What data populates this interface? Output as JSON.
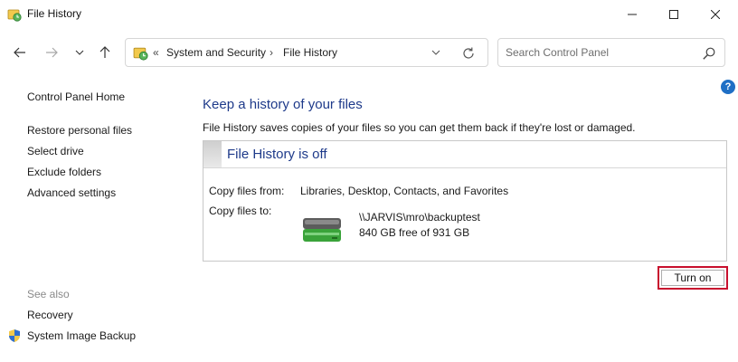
{
  "window": {
    "title": "File History",
    "icon": "file-history-icon"
  },
  "nav": {
    "back_icon": "arrow-left-icon",
    "forward_icon": "arrow-right-icon",
    "recent_icon": "chevron-down-icon",
    "up_icon": "arrow-up-icon"
  },
  "address": {
    "overflow": "«",
    "crumbs": [
      "System and Security",
      "File History"
    ],
    "separator": "›"
  },
  "search": {
    "placeholder": "Search Control Panel"
  },
  "help": {
    "label": "?"
  },
  "sidebar": {
    "home": "Control Panel Home",
    "items": [
      "Restore personal files",
      "Select drive",
      "Exclude folders",
      "Advanced settings"
    ],
    "see_also": "See also",
    "see_also_items": [
      "Recovery",
      "System Image Backup"
    ]
  },
  "main": {
    "title": "Keep a history of your files",
    "description": "File History saves copies of your files so you can get them back if they're lost or damaged.",
    "status": "File History is off",
    "copy_from_label": "Copy files from:",
    "copy_from_value": "Libraries, Desktop, Contacts, and Favorites",
    "copy_to_label": "Copy files to:",
    "drive_path": "\\\\JARVIS\\mro\\backuptest",
    "drive_free": "840 GB free of 931 GB",
    "turn_on_label": "Turn on"
  },
  "colors": {
    "accent_title": "#1e3a8a",
    "highlight_border": "#c8102e",
    "help_blue": "#1f6fc5"
  }
}
